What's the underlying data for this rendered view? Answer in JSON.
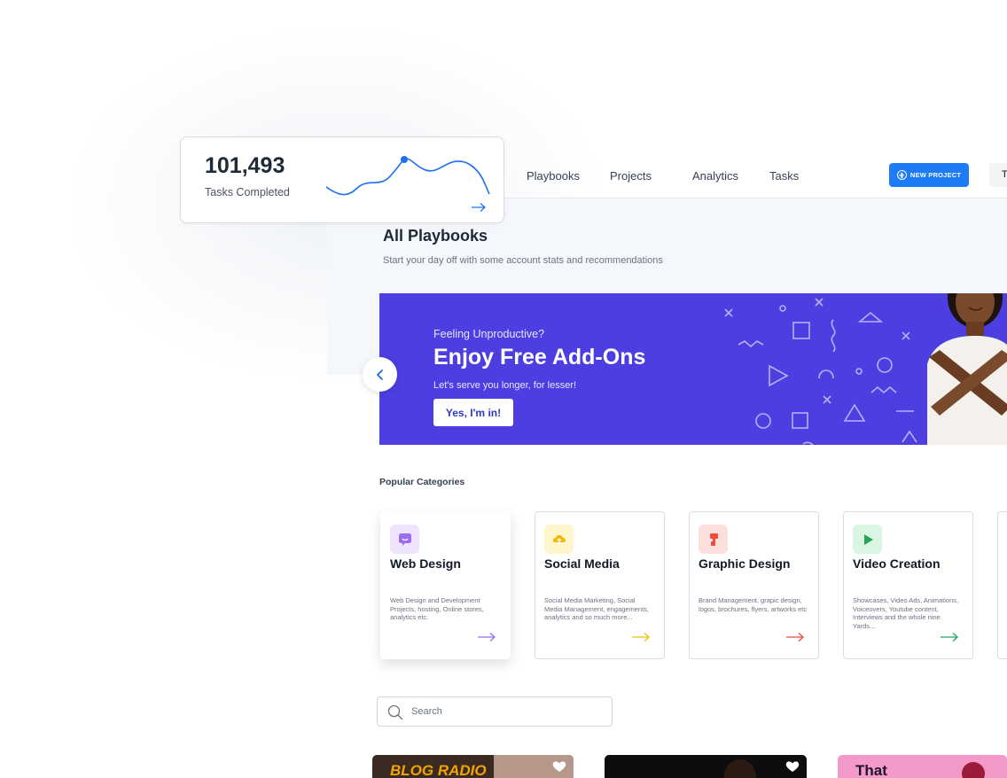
{
  "stats": {
    "value": "101,493",
    "label": "Tasks Completed"
  },
  "nav": {
    "links": [
      "Playbooks",
      "Projects",
      "Analytics",
      "Tasks"
    ],
    "new_project_label": "NEW PROJECT",
    "extra_label": "T"
  },
  "page": {
    "title": "All Playbooks",
    "subtitle": "Start your day off with some account stats and recommendations"
  },
  "banner": {
    "eyebrow": "Feeling Unproductive?",
    "title": "Enjoy Free Add-Ons",
    "description": "Let's serve you longer, for lesser!",
    "cta": "Yes, I'm in!",
    "color": "#4c3ee0"
  },
  "categories_title": "Popular Categories",
  "categories": [
    {
      "title": "Web Design",
      "desc": "Web Design and Development Projects, hosting, Online stores, analytics etc.",
      "icon": "chat-icon",
      "accent": "#9b6cf0",
      "tint": "#efe4fe"
    },
    {
      "title": "Social Media",
      "desc": "Social Media Marketing, Social Media Management, engagements, analytics and so much more...",
      "icon": "cloud-icon",
      "accent": "#f2c000",
      "tint": "#fff6cc"
    },
    {
      "title": "Graphic Design",
      "desc": "Brand Management, grapic design, logos, brochures, flyers, artworks etc",
      "icon": "brush-icon",
      "accent": "#ef4a3c",
      "tint": "#fde0dc"
    },
    {
      "title": "Video Creation",
      "desc": "Showcases, Video Ads, Animations, Voiceovers, Youtube content, Interviews and the whole nine Yards...",
      "icon": "play-icon",
      "accent": "#23a55a",
      "tint": "#dbf5e3"
    }
  ],
  "search": {
    "placeholder": "Search"
  },
  "thumbnails": [
    {
      "text": "BLOG RADIO"
    },
    {
      "text": ""
    },
    {
      "text": "That"
    }
  ]
}
